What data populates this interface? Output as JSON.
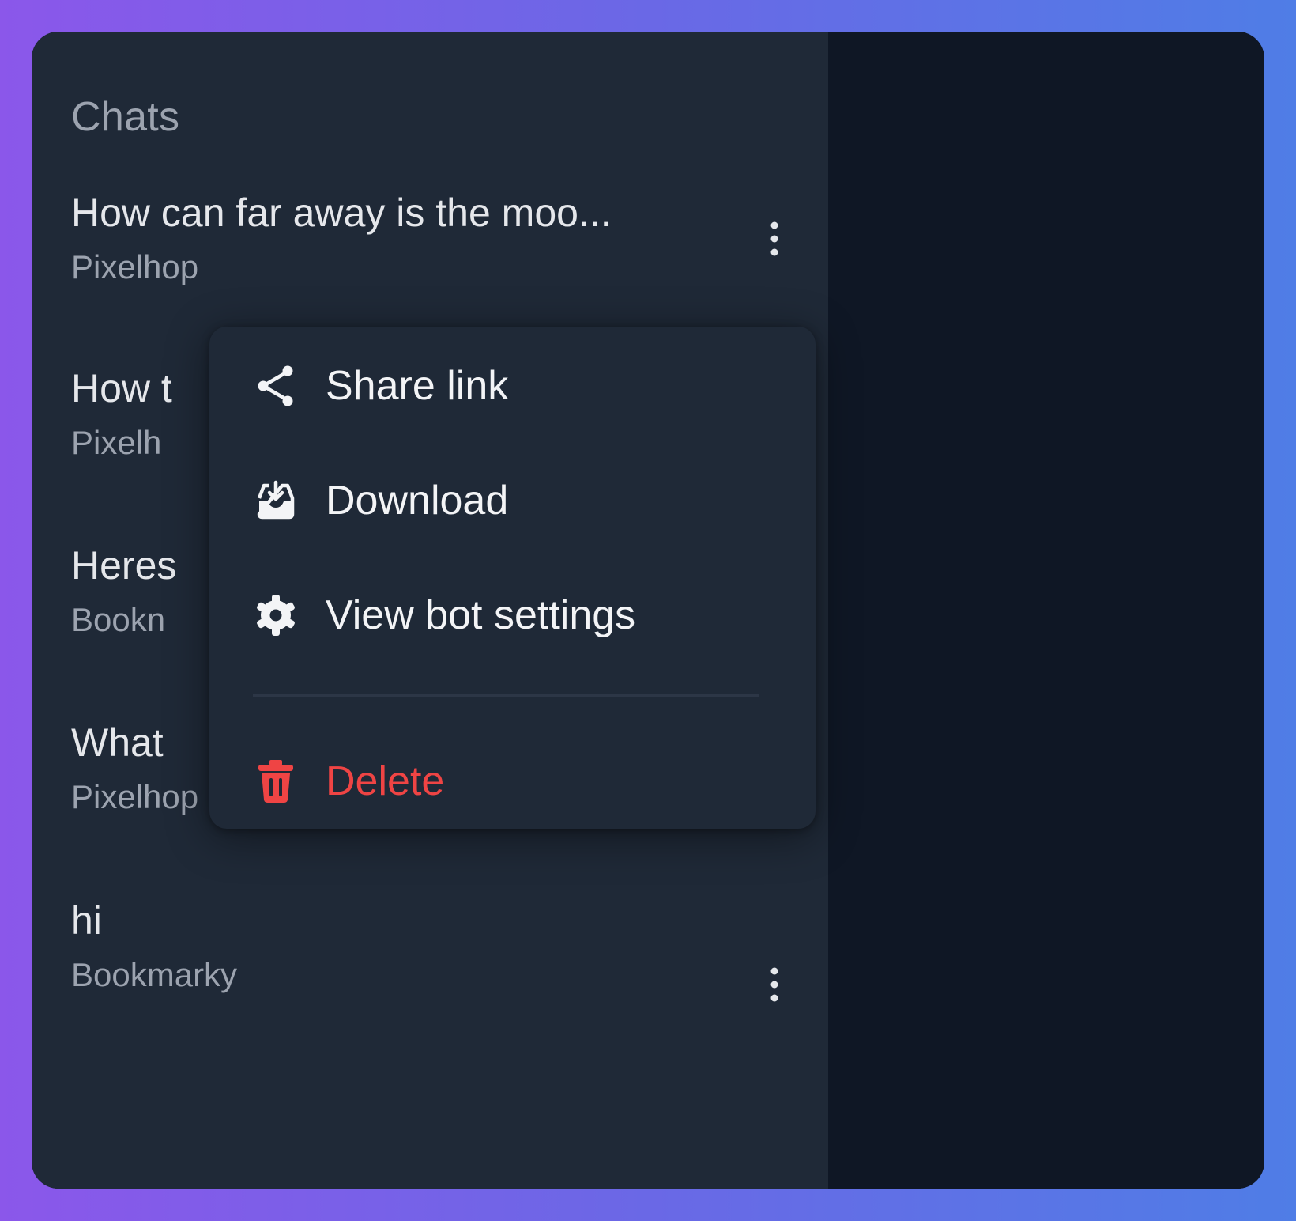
{
  "sidebar": {
    "title": "Chats",
    "chats": [
      {
        "title": "How can far away is the moo...",
        "bot": "Pixelhop"
      },
      {
        "title": "How t",
        "bot": "Pixelh"
      },
      {
        "title": "Heres",
        "bot": "Bookn"
      },
      {
        "title": "What",
        "bot": "Pixelhop"
      },
      {
        "title": "hi",
        "bot": "Bookmarky"
      }
    ]
  },
  "context_menu": {
    "items": [
      {
        "label": "Share link",
        "icon": "share-icon"
      },
      {
        "label": "Download",
        "icon": "download-tray-icon"
      },
      {
        "label": "View bot settings",
        "icon": "gear-icon"
      },
      {
        "label": "Delete",
        "icon": "trash-icon",
        "color": "#ef4444"
      }
    ]
  },
  "colors": {
    "background_gradient_start": "#8b57ea",
    "background_gradient_end": "#4f7de6",
    "sidebar": "#1f2937",
    "main_panel": "#0f1725",
    "danger": "#ef4444"
  }
}
